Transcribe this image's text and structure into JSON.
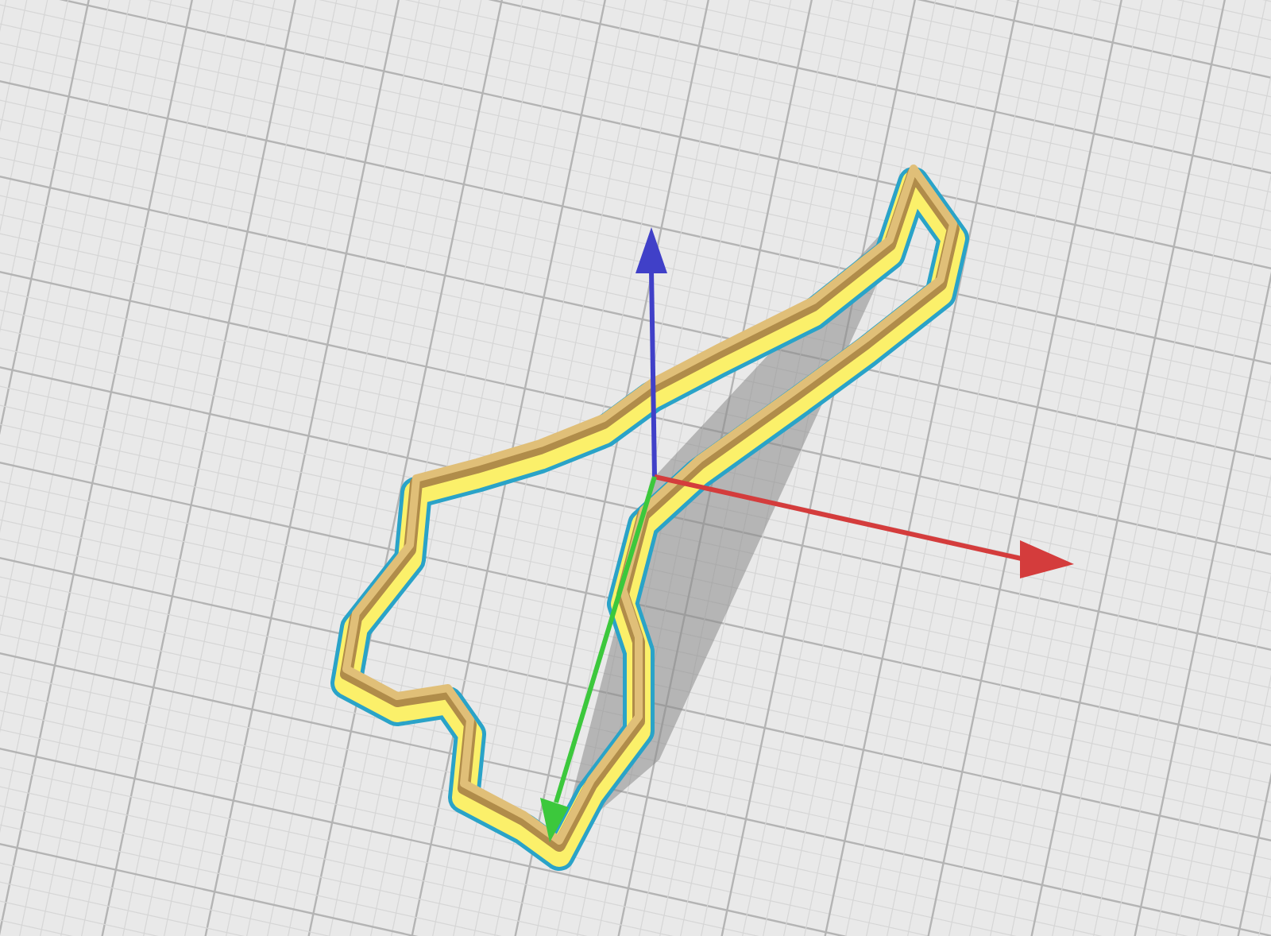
{
  "viewport": {
    "kind": "build-plate"
  },
  "model": {
    "kind": "outline-shape"
  },
  "axes": [
    {
      "kind": "up",
      "color": "#4040c8"
    },
    {
      "kind": "right",
      "color": "#d43c3c"
    },
    {
      "kind": "down",
      "color": "#3cc83c"
    }
  ]
}
